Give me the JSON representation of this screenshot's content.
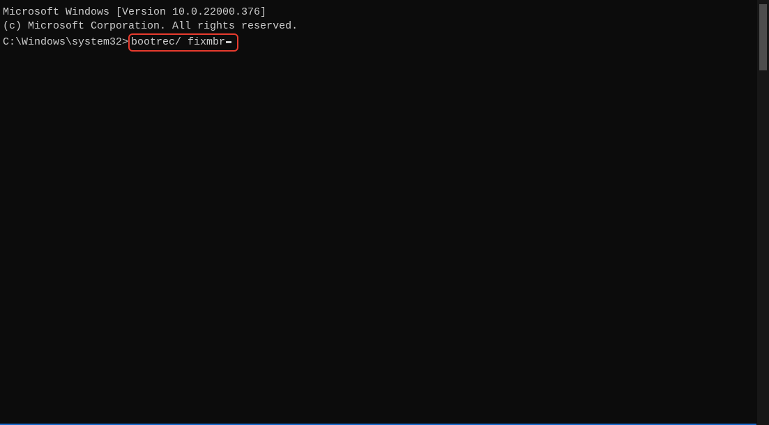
{
  "terminal": {
    "header_line_1": "Microsoft Windows [Version 10.0.22000.376]",
    "header_line_2": "(c) Microsoft Corporation. All rights reserved.",
    "blank_line": "",
    "prompt_path": "C:\\Windows\\system32>",
    "command_typed": "bootrec/ fixmbr"
  }
}
